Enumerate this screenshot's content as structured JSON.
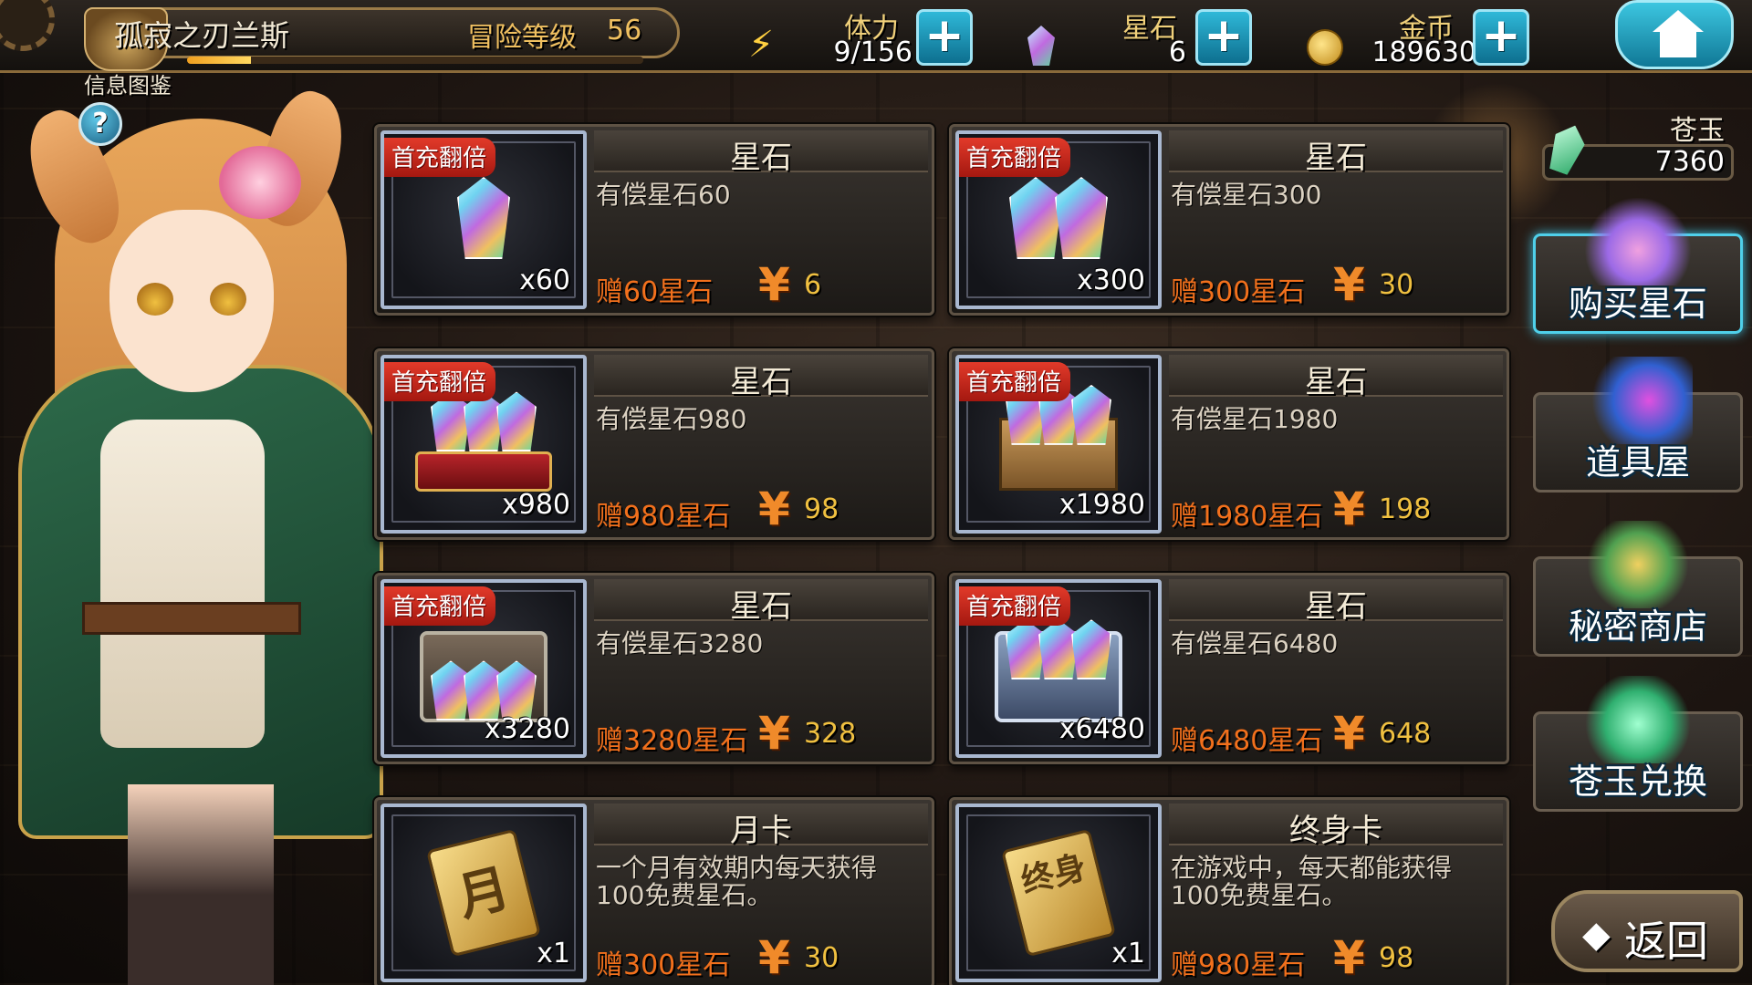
{
  "header": {
    "player_name": "孤寂之刃兰斯",
    "adventure_label": "冒险等级",
    "adventure_level": "56",
    "info_label": "信息图鉴",
    "help_symbol": "?",
    "xp_progress": 0.14
  },
  "resources": {
    "stamina": {
      "label": "体力",
      "value": "9/156",
      "icon": "lightning-icon"
    },
    "star_stone": {
      "label": "星石",
      "value": "6",
      "icon": "crystal-icon"
    },
    "gold": {
      "label": "金币",
      "value": "189630",
      "icon": "coin-icon"
    },
    "plus_symbol": "+"
  },
  "products": [
    {
      "badge": "首充翻倍",
      "title": "星石",
      "desc": "有偿星石60",
      "qty": "x60",
      "bonus": "赠60星石",
      "currency": "¥",
      "price": "6",
      "visual": "gem-1"
    },
    {
      "badge": "首充翻倍",
      "title": "星石",
      "desc": "有偿星石300",
      "qty": "x300",
      "bonus": "赠300星石",
      "currency": "¥",
      "price": "30",
      "visual": "gem-2"
    },
    {
      "badge": "首充翻倍",
      "title": "星石",
      "desc": "有偿星石980",
      "qty": "x980",
      "bonus": "赠980星石",
      "currency": "¥",
      "price": "98",
      "visual": "gem-carpet"
    },
    {
      "badge": "首充翻倍",
      "title": "星石",
      "desc": "有偿星石1980",
      "qty": "x1980",
      "bonus": "赠1980星石",
      "currency": "¥",
      "price": "198",
      "visual": "gem-crate"
    },
    {
      "badge": "首充翻倍",
      "title": "星石",
      "desc": "有偿星石3280",
      "qty": "x3280",
      "bonus": "赠3280星石",
      "currency": "¥",
      "price": "328",
      "visual": "gem-chest"
    },
    {
      "badge": "首充翻倍",
      "title": "星石",
      "desc": "有偿星石6480",
      "qty": "x6480",
      "bonus": "赠6480星石",
      "currency": "¥",
      "price": "648",
      "visual": "gem-silver-chest"
    },
    {
      "badge": "",
      "title": "月卡",
      "desc": "一个月有效期内每天获得100免费星石。",
      "qty": "x1",
      "bonus": "赠300星石",
      "currency": "¥",
      "price": "30",
      "visual": "month-card",
      "ticket_text": "月"
    },
    {
      "badge": "",
      "title": "终身卡",
      "desc": "在游戏中，每天都能获得100免费星石。",
      "qty": "x1",
      "bonus": "赠980星石",
      "currency": "¥",
      "price": "98",
      "visual": "lifetime-card",
      "ticket_text": "终身"
    }
  ],
  "sidebar": {
    "jade_label": "苍玉",
    "jade_value": "7360",
    "buttons": [
      {
        "label": "购买星石",
        "icon": "gem-pile-icon",
        "active": true
      },
      {
        "label": "道具屋",
        "icon": "potion-shop-icon",
        "active": false
      },
      {
        "label": "秘密商店",
        "icon": "backpack-icon",
        "active": false
      },
      {
        "label": "苍玉兑换",
        "icon": "jade-crystal-icon",
        "active": false
      }
    ],
    "back_label": "返回",
    "back_arrow": "◆"
  },
  "colors": {
    "bonus_text": "#f2701c",
    "price_text": "#f0c040",
    "badge_red": "#e23a2a",
    "accent_cyan": "#2fb8d8"
  }
}
